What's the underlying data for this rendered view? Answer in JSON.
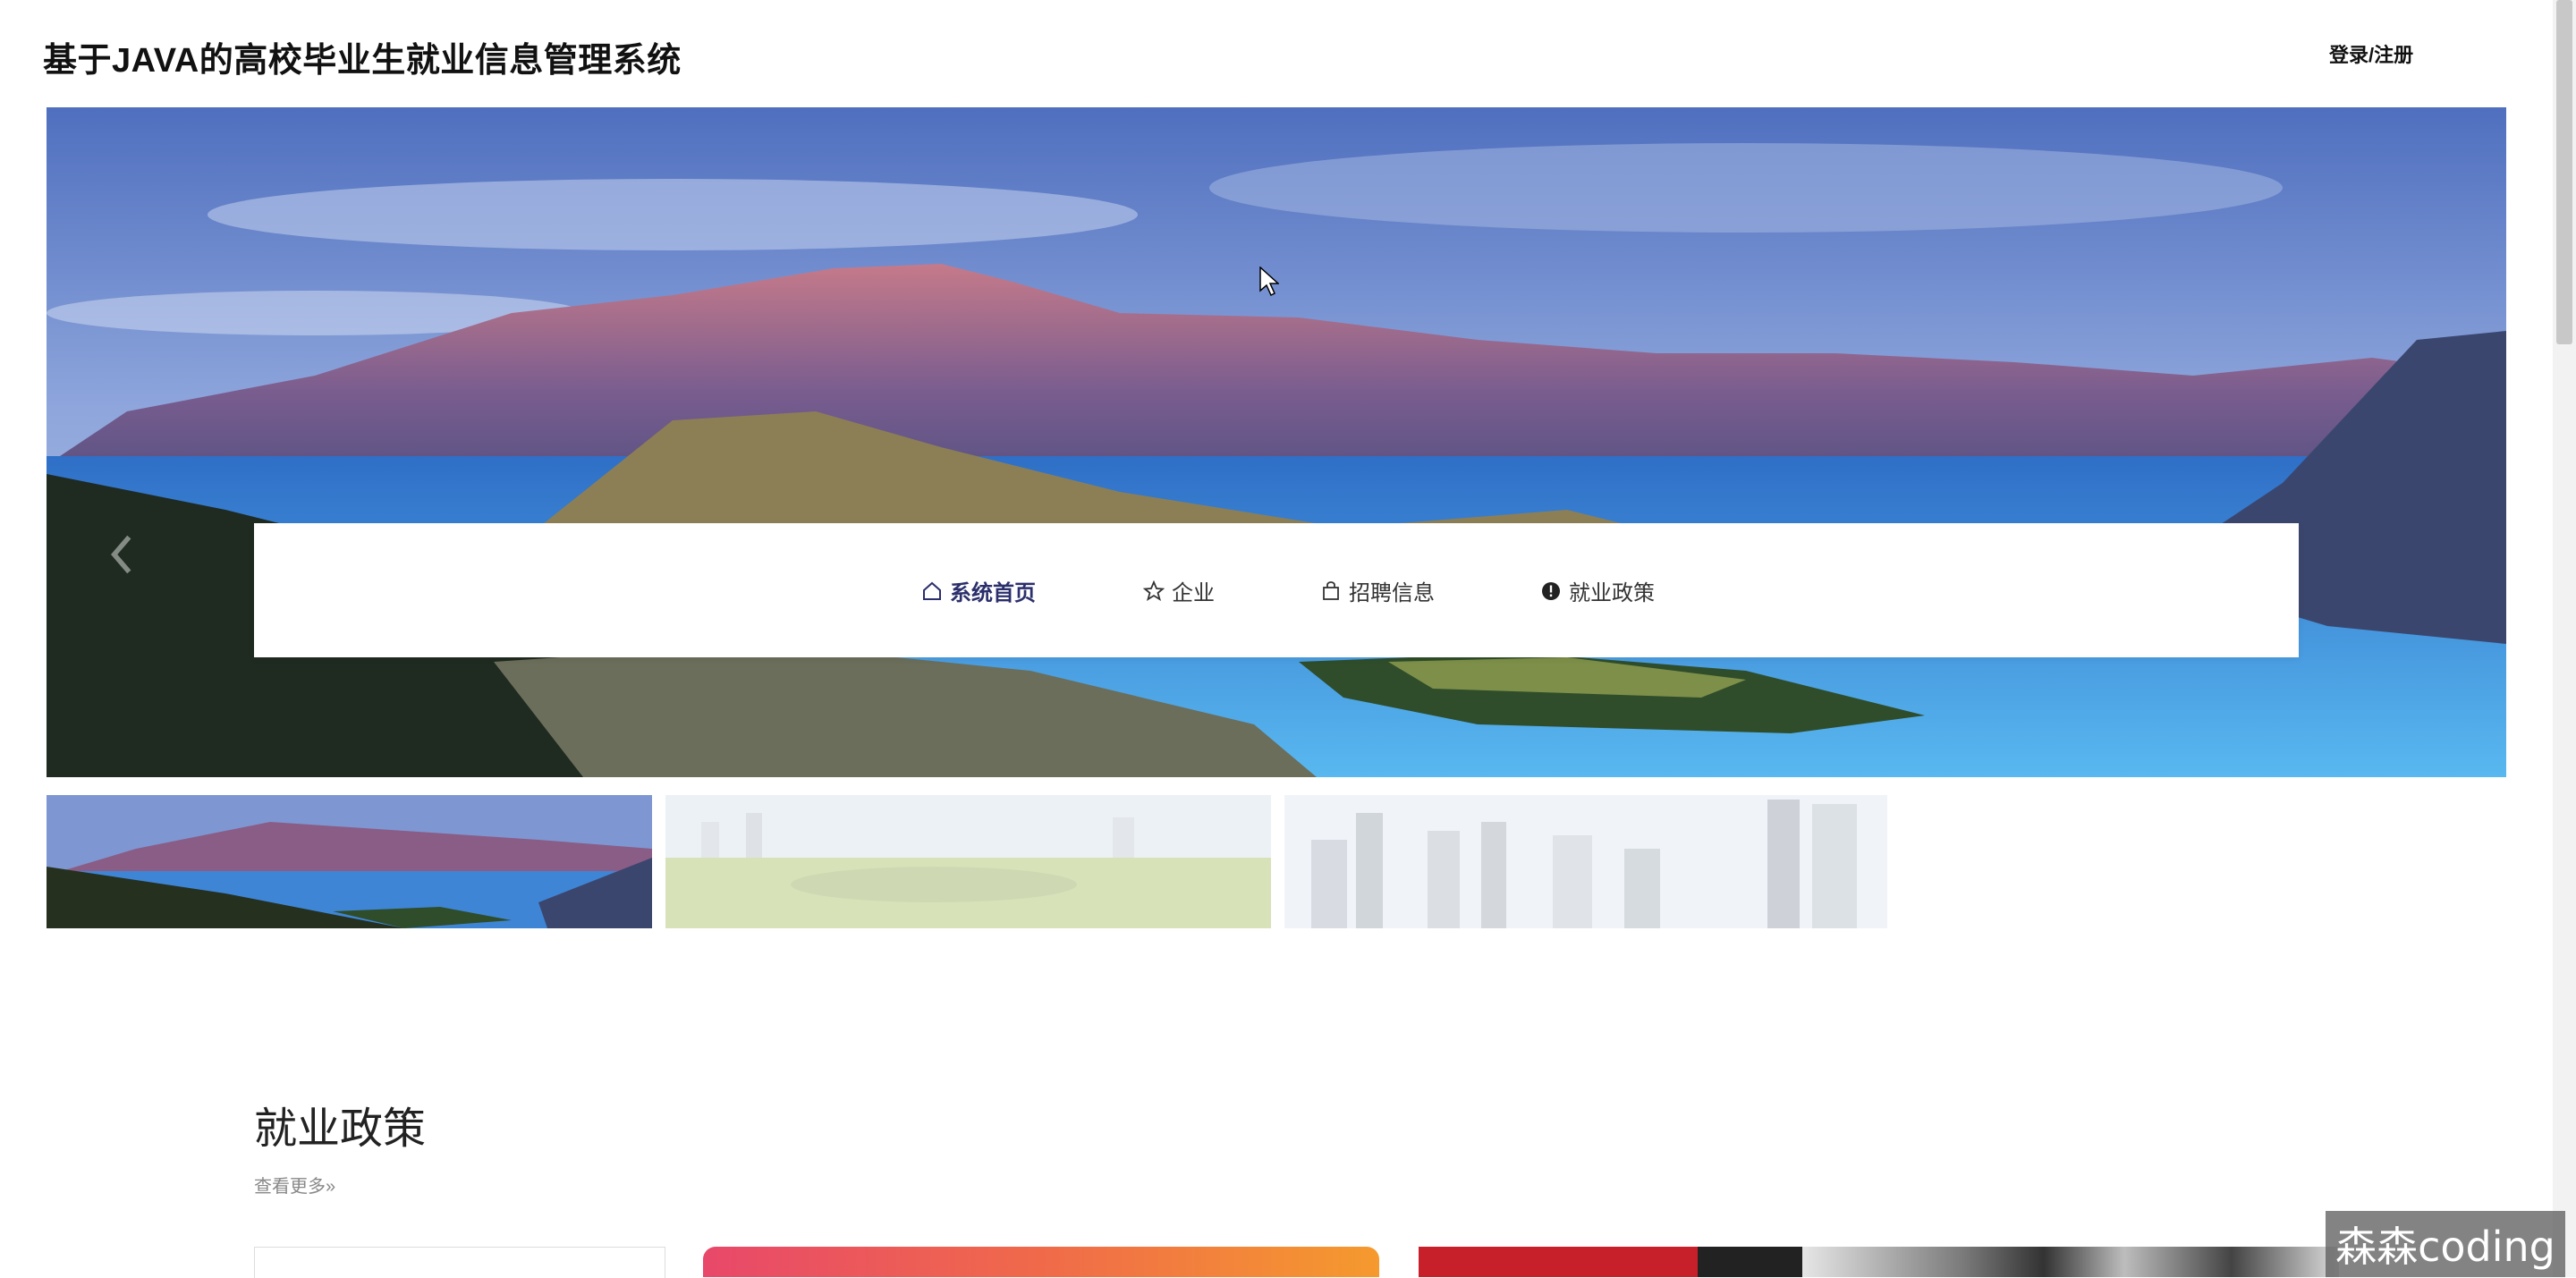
{
  "header": {
    "site_title": "基于JAVA的高校毕业生就业信息管理系统",
    "login_label": "登录/注册"
  },
  "carousel": {
    "prev_icon": "chevron-left-icon",
    "next_icon": "chevron-right-icon",
    "thumbnails": [
      "lake-mountains",
      "city-park",
      "city-skyline"
    ],
    "active_index": 0
  },
  "nav": {
    "items": [
      {
        "label": "系统首页",
        "icon": "home-icon",
        "active": true
      },
      {
        "label": "企业",
        "icon": "star-icon",
        "active": false
      },
      {
        "label": "招聘信息",
        "icon": "bag-icon",
        "active": false
      },
      {
        "label": "就业政策",
        "icon": "exclamation-circle-icon",
        "active": false
      }
    ]
  },
  "policy_section": {
    "title": "就业政策",
    "more_label": "查看更多»"
  },
  "watermark": {
    "text": "森森coding"
  },
  "colors": {
    "nav_active": "#2b2f6b",
    "nav_text": "#333333"
  }
}
